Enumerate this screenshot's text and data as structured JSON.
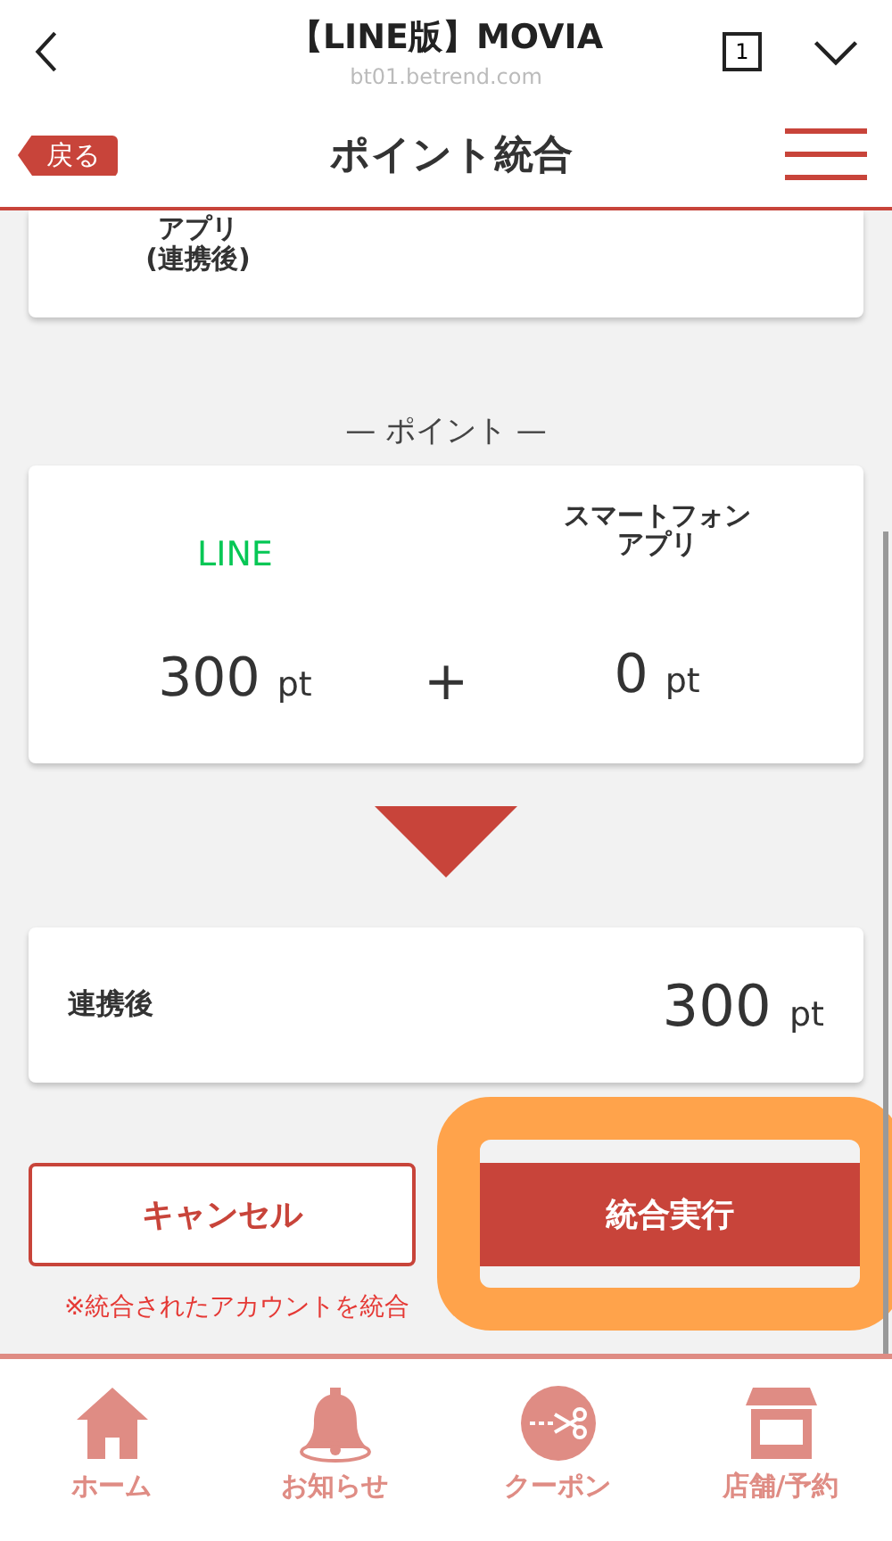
{
  "browser_bar": {
    "title": "【LINE版】MOVIA",
    "url": "bt01.betrend.com",
    "tab_count": "1"
  },
  "nav": {
    "back": "戻る",
    "title": "ポイント統合"
  },
  "top_card": {
    "label_lines": [
      "アプリ",
      "(連携後)"
    ]
  },
  "section_title": "— ポイント —",
  "points_card": {
    "columns": [
      {
        "name_lines": [
          "LINE"
        ],
        "color": "#06c755",
        "value": "300",
        "unit": "pt"
      },
      {
        "name_lines": [
          "スマートフォン",
          "アプリ"
        ],
        "color": "#333333",
        "value": "0",
        "unit": "pt"
      }
    ],
    "operator": "+"
  },
  "result_card": {
    "label": "連携後",
    "value": "300",
    "unit": "pt"
  },
  "buttons": [
    {
      "label": "キャンセル",
      "kind": "outline",
      "highlighted": false
    },
    {
      "label": "統合実行",
      "kind": "filled",
      "highlighted": true
    }
  ],
  "note": "※統合されたアカウントを統合",
  "tab_bar": [
    {
      "label": "ホーム",
      "kind": "home"
    },
    {
      "label": "お知らせ",
      "kind": "bell"
    },
    {
      "label": "クーポン",
      "kind": "coupon"
    },
    {
      "label": "店舗/予約",
      "kind": "shop"
    }
  ]
}
